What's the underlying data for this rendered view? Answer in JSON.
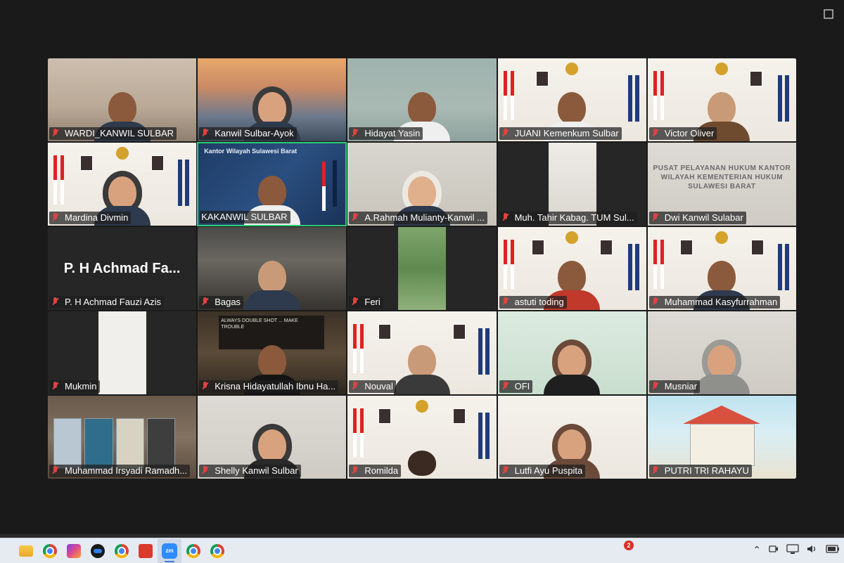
{
  "meeting": {
    "participants": [
      {
        "name": "WARDI_KANWIL SULBAR",
        "bg": "office",
        "muted": true
      },
      {
        "name": "Kanwil Sulbar-Ayok",
        "bg": "bridge",
        "muted": true
      },
      {
        "name": "Hidayat Yasin",
        "bg": "wall",
        "muted": true
      },
      {
        "name": "JUANI Kemenkum Sulbar",
        "bg": "white",
        "muted": true
      },
      {
        "name": "Victor Oliver",
        "bg": "white",
        "muted": true
      },
      {
        "name": "Mardina Divmin",
        "bg": "white",
        "muted": true
      },
      {
        "name": "KAKANWIL SULBAR",
        "bg": "navy",
        "muted": false,
        "active": true,
        "header": "Kantor Wilayah Sulawesi Barat"
      },
      {
        "name": "A.Rahmah Mulianty-Kanwil ...",
        "bg": "pale",
        "muted": true
      },
      {
        "name": "Muh.  Tahir  Kabag. TUM Sul...",
        "bg": "dark",
        "muted": true
      },
      {
        "name": "Dwi Kanwil Sulabar",
        "bg": "grey",
        "muted": true,
        "sign": "PUSAT PELAYANAN HUKUM KANTOR WILAYAH KEMENTERIAN HUKUM SULAWESI BARAT"
      },
      {
        "name": "P. H Achmad Fauzi Azis",
        "bg": "dark",
        "muted": true,
        "display_name": "P. H Achmad Fa..."
      },
      {
        "name": "Bagas",
        "bg": "room",
        "muted": true
      },
      {
        "name": "Feri",
        "bg": "leaves",
        "muted": true
      },
      {
        "name": "astuti toding",
        "bg": "white",
        "muted": true
      },
      {
        "name": "Muhammad Kasyfurrahman",
        "bg": "white",
        "muted": true
      },
      {
        "name": "Mukmin",
        "bg": "dark",
        "muted": true
      },
      {
        "name": "Krisna Hidayatullah Ibnu Ha...",
        "bg": "cafe",
        "muted": true,
        "board": "ALWAYS DOUBLE SHOT ... MAKE TROUBLE"
      },
      {
        "name": "Nouval",
        "bg": "white",
        "muted": true
      },
      {
        "name": "OFI",
        "bg": "green",
        "muted": true
      },
      {
        "name": "Musniar",
        "bg": "grey",
        "muted": true
      },
      {
        "name": "Muhammad Irsyadi Ramadh...",
        "bg": "books",
        "muted": true
      },
      {
        "name": "Shelly Kanwil Sulbar",
        "bg": "grey",
        "muted": true
      },
      {
        "name": "Romilda",
        "bg": "white",
        "muted": true
      },
      {
        "name": "Lutfi Ayu Puspita",
        "bg": "white",
        "muted": true
      },
      {
        "name": "PUTRI TRI RAHAYU",
        "bg": "cartoon",
        "muted": true
      }
    ]
  },
  "taskbar": {
    "apps": [
      "file-explorer",
      "chrome",
      "office",
      "teamviewer",
      "chrome",
      "pdf-reader",
      "zoom",
      "chrome",
      "chrome"
    ],
    "zoom_label": "zm",
    "notification_count": "2",
    "tray": [
      "chevron-up-icon",
      "meet-now-icon",
      "network-icon",
      "volume-icon",
      "battery-icon"
    ]
  },
  "colors": {
    "active_speaker_border": "#2ecc71",
    "muted_icon": "#e04343",
    "taskbar": "#e6ebf2"
  }
}
